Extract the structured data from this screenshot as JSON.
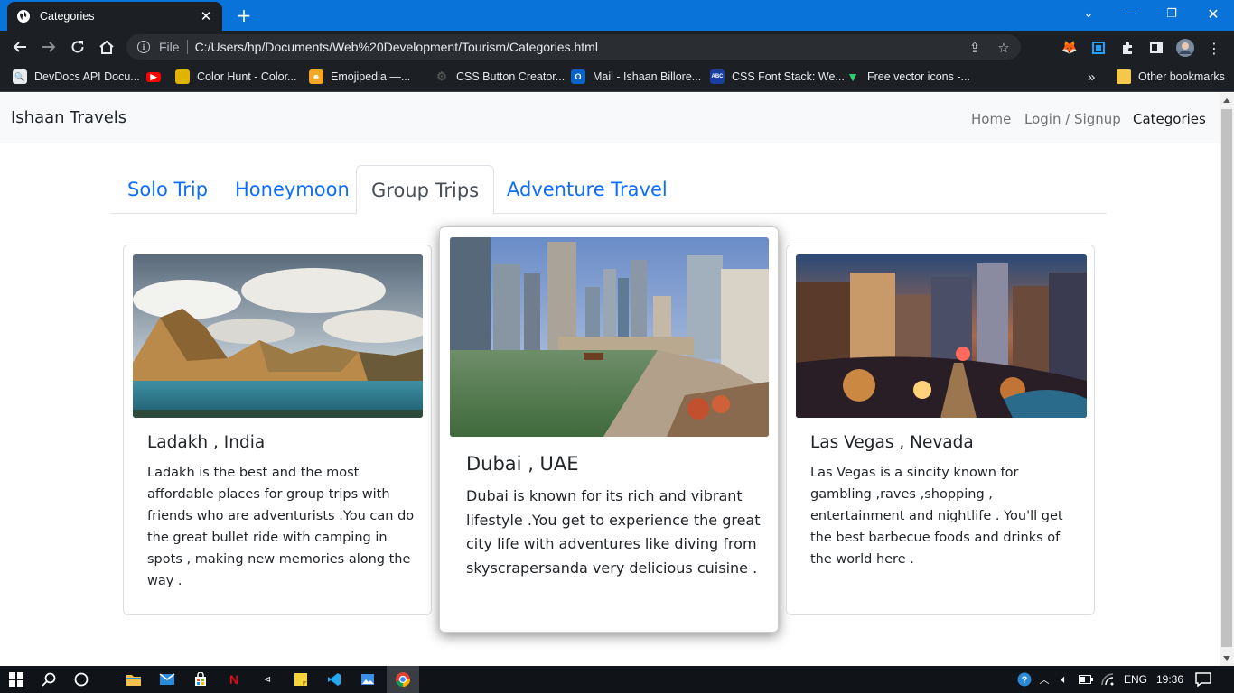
{
  "browser": {
    "tab_title": "Categories",
    "url_scheme_label": "File",
    "url": "C:/Users/hp/Documents/Web%20Development/Tourism/Categories.html",
    "bookmarks": [
      {
        "label": "DevDocs API Docu...",
        "icon": "devdocs-icon",
        "color": "#444"
      },
      {
        "label": "",
        "icon": "youtube-icon",
        "color": "#ff0000"
      },
      {
        "label": "Color Hunt - Color...",
        "icon": "colorhunt-icon",
        "color": "#e0b400"
      },
      {
        "label": "Emojipedia —...",
        "icon": "emojipedia-icon",
        "color": "#f5a623"
      },
      {
        "label": "CSS Button Creator...",
        "icon": "gear-icon",
        "color": "#555"
      },
      {
        "label": "Mail - Ishaan Billore...",
        "icon": "outlook-icon",
        "color": "#0a64c8"
      },
      {
        "label": "CSS Font Stack: We...",
        "icon": "cssfontstack-icon",
        "color": "#1a3e9e"
      },
      {
        "label": "Free vector icons -...",
        "icon": "vector-icon",
        "color": "#2ecc71"
      }
    ],
    "other_bookmarks": "Other bookmarks",
    "more_bookmarks": "»"
  },
  "site": {
    "brand": "Ishaan Travels",
    "nav": [
      {
        "label": "Home",
        "active": false
      },
      {
        "label": "Login / Signup",
        "active": false
      },
      {
        "label": "Categories",
        "active": true
      }
    ],
    "tabs": [
      {
        "label": "Solo Trip",
        "active": false
      },
      {
        "label": "Honeymoon",
        "active": false
      },
      {
        "label": "Group Trips",
        "active": true
      },
      {
        "label": "Adventure Travel",
        "active": false
      }
    ],
    "cards": [
      {
        "title": "Ladakh , India",
        "text": "Ladakh is the best and the most affordable places for group trips with friends who are adventurists .You can do the great bullet ride with camping in spots , making new memories along the way .",
        "image": "mountain-lake-image"
      },
      {
        "title": "Dubai , UAE",
        "text": "Dubai is known for its rich and vibrant lifestyle .You get to experience the great city life with adventures like diving from skyscrapersanda very delicious cuisine .",
        "image": "dubai-marina-image"
      },
      {
        "title": "Las Vegas , Nevada",
        "text": "Las Vegas is a sincity known for gambling ,raves ,shopping , entertainment and nightlife . You'll get the best barbecue foods and drinks of the world here .",
        "image": "las-vegas-night-image"
      }
    ]
  },
  "taskbar": {
    "language": "ENG",
    "time": "19:36"
  }
}
